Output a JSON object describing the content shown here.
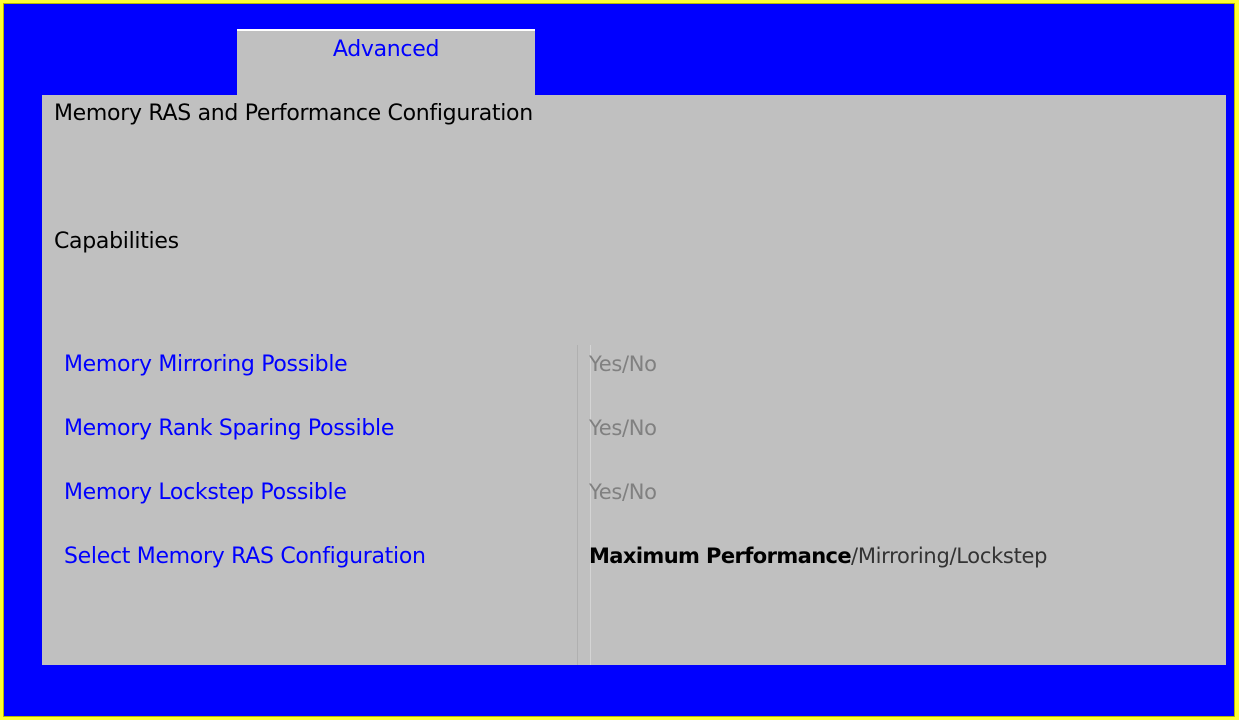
{
  "tabs": [
    {
      "label": "Advanced",
      "selected": true
    }
  ],
  "page": {
    "title": "Memory RAS and Performance Configuration"
  },
  "section": {
    "label": "Capabilities"
  },
  "rows": [
    {
      "label": "Memory Mirroring Possible",
      "value": "Yes/No"
    },
    {
      "label": "Memory Rank Sparing Possible",
      "value": "Yes/No"
    },
    {
      "label": "Memory Lockstep Possible",
      "value": "Yes/No"
    }
  ],
  "select_row": {
    "label": "Select Memory RAS Configuration",
    "selected_option": "Maximum Performance",
    "other_options": "/Mirroring/Lockstep"
  },
  "colors": {
    "frame": "#0000ff",
    "panel": "#c0c0c0",
    "border": "#ffff33",
    "label_text": "#0000ff",
    "readonly_value": "#808080"
  }
}
